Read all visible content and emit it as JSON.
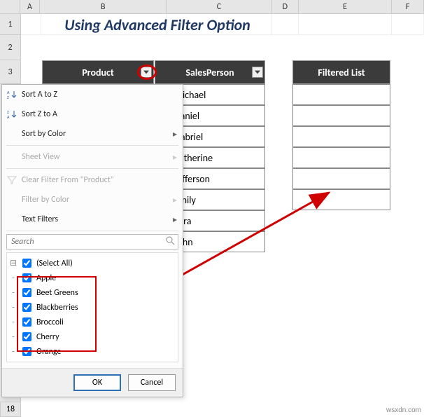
{
  "cols": [
    "A",
    "B",
    "C",
    "D",
    "E",
    "F"
  ],
  "rows": [
    "1",
    "2",
    "3"
  ],
  "row18": "18",
  "title": "Using Advanced Filter Option",
  "columns": {
    "product": "Product",
    "sales": "SalesPerson",
    "filtered": "Filtered List"
  },
  "sales": [
    "Michael",
    "Daniel",
    "Gabriel",
    "Katherine",
    "Jefferson",
    "Emily",
    "Sara",
    "John"
  ],
  "menu": {
    "sort_asc": "Sort A to Z",
    "sort_desc": "Sort Z to A",
    "sort_color": "Sort by Color",
    "sheet_view": "Sheet View",
    "clear": "Clear Filter From \"Product\"",
    "filter_color": "Filter by Color",
    "text_filters": "Text Filters",
    "search_ph": "Search",
    "select_all": "(Select All)",
    "items": [
      "Apple",
      "Beet Greens",
      "Blackberries",
      "Broccoli",
      "Cherry",
      "Orange"
    ],
    "ok": "OK",
    "cancel": "Cancel"
  },
  "watermark": "wsxdn.com"
}
